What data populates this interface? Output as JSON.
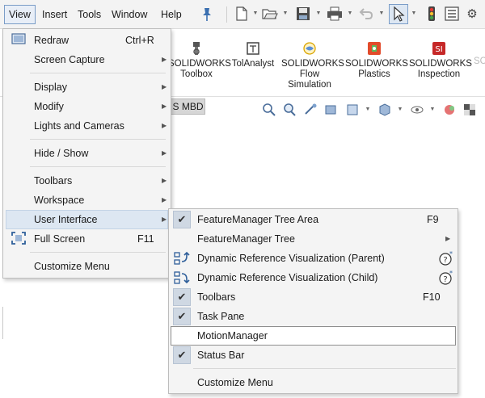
{
  "menubar": {
    "items": [
      "View",
      "Insert",
      "Tools",
      "Window",
      "Help"
    ],
    "active": "View",
    "quick_access_icons": [
      "new-document-icon",
      "open-icon",
      "save-icon",
      "print-icon",
      "undo-icon",
      "select-icon",
      "rebuild-icon",
      "file-properties-icon",
      "options-icon"
    ]
  },
  "ribbon": {
    "buttons": [
      {
        "label_1": "SOLIDWORKS",
        "label_2": "Toolbox",
        "label_3": "",
        "icon": "toolbox-icon"
      },
      {
        "label_1": "TolAnalyst",
        "label_2": "",
        "label_3": "",
        "icon": "tolanalyst-icon"
      },
      {
        "label_1": "SOLIDWORKS",
        "label_2": "Flow",
        "label_3": "Simulation",
        "icon": "flow-simulation-icon"
      },
      {
        "label_1": "SOLIDWORKS",
        "label_2": "Plastics",
        "label_3": "",
        "icon": "plastics-icon"
      },
      {
        "label_1": "SOLIDWORKS",
        "label_2": "Inspection",
        "label_3": "",
        "icon": "inspection-icon"
      },
      {
        "label_1": "SC",
        "label_2": "",
        "label_3": "",
        "icon": ""
      }
    ],
    "tab_partial": "S MBD"
  },
  "view_menu": {
    "items": [
      {
        "label": "Redraw",
        "shortcut": "Ctrl+R",
        "submenu": false,
        "icon": "redraw-icon"
      },
      {
        "label": "Screen Capture",
        "shortcut": "",
        "submenu": true,
        "icon": ""
      },
      {
        "label": "Display",
        "shortcut": "",
        "submenu": true,
        "icon": ""
      },
      {
        "label": "Modify",
        "shortcut": "",
        "submenu": true,
        "icon": ""
      },
      {
        "label": "Lights and Cameras",
        "shortcut": "",
        "submenu": true,
        "icon": ""
      },
      {
        "label": "Hide / Show",
        "shortcut": "",
        "submenu": true,
        "icon": ""
      },
      {
        "label": "Toolbars",
        "shortcut": "",
        "submenu": true,
        "icon": ""
      },
      {
        "label": "Workspace",
        "shortcut": "",
        "submenu": true,
        "icon": ""
      },
      {
        "label": "User Interface",
        "shortcut": "",
        "submenu": true,
        "icon": "",
        "highlighted": true
      },
      {
        "label": "Full Screen",
        "shortcut": "F11",
        "submenu": false,
        "icon": "full-screen-icon"
      },
      {
        "label": "Customize Menu",
        "shortcut": "",
        "submenu": false,
        "icon": ""
      }
    ]
  },
  "user_interface_menu": {
    "items": [
      {
        "label": "FeatureManager Tree Area",
        "shortcut": "F9",
        "checked": true
      },
      {
        "label": "FeatureManager Tree",
        "shortcut": "",
        "checked": false,
        "submenu": true
      },
      {
        "label": "Dynamic Reference Visualization (Parent)",
        "shortcut": "",
        "checked": false,
        "help": true,
        "icon": "dynamic-reference-parent-icon"
      },
      {
        "label": "Dynamic Reference Visualization (Child)",
        "shortcut": "",
        "checked": false,
        "help": true,
        "icon": "dynamic-reference-child-icon"
      },
      {
        "label": "Toolbars",
        "shortcut": "F10",
        "checked": true
      },
      {
        "label": "Task Pane",
        "shortcut": "",
        "checked": true
      },
      {
        "label": "MotionManager",
        "shortcut": "",
        "checked": false,
        "highlighted": true
      },
      {
        "label": "Status Bar",
        "shortcut": "",
        "checked": true
      },
      {
        "label": "Customize Menu",
        "shortcut": "",
        "checked": false
      }
    ]
  },
  "check_glyph": "✔",
  "arrow_glyph": "▶",
  "colors": {
    "menu_bg": "#f4f4f4",
    "highlight_bg": "#dde7f2",
    "check_bg": "#cfd8e3",
    "accent": "#3a6fb0"
  }
}
